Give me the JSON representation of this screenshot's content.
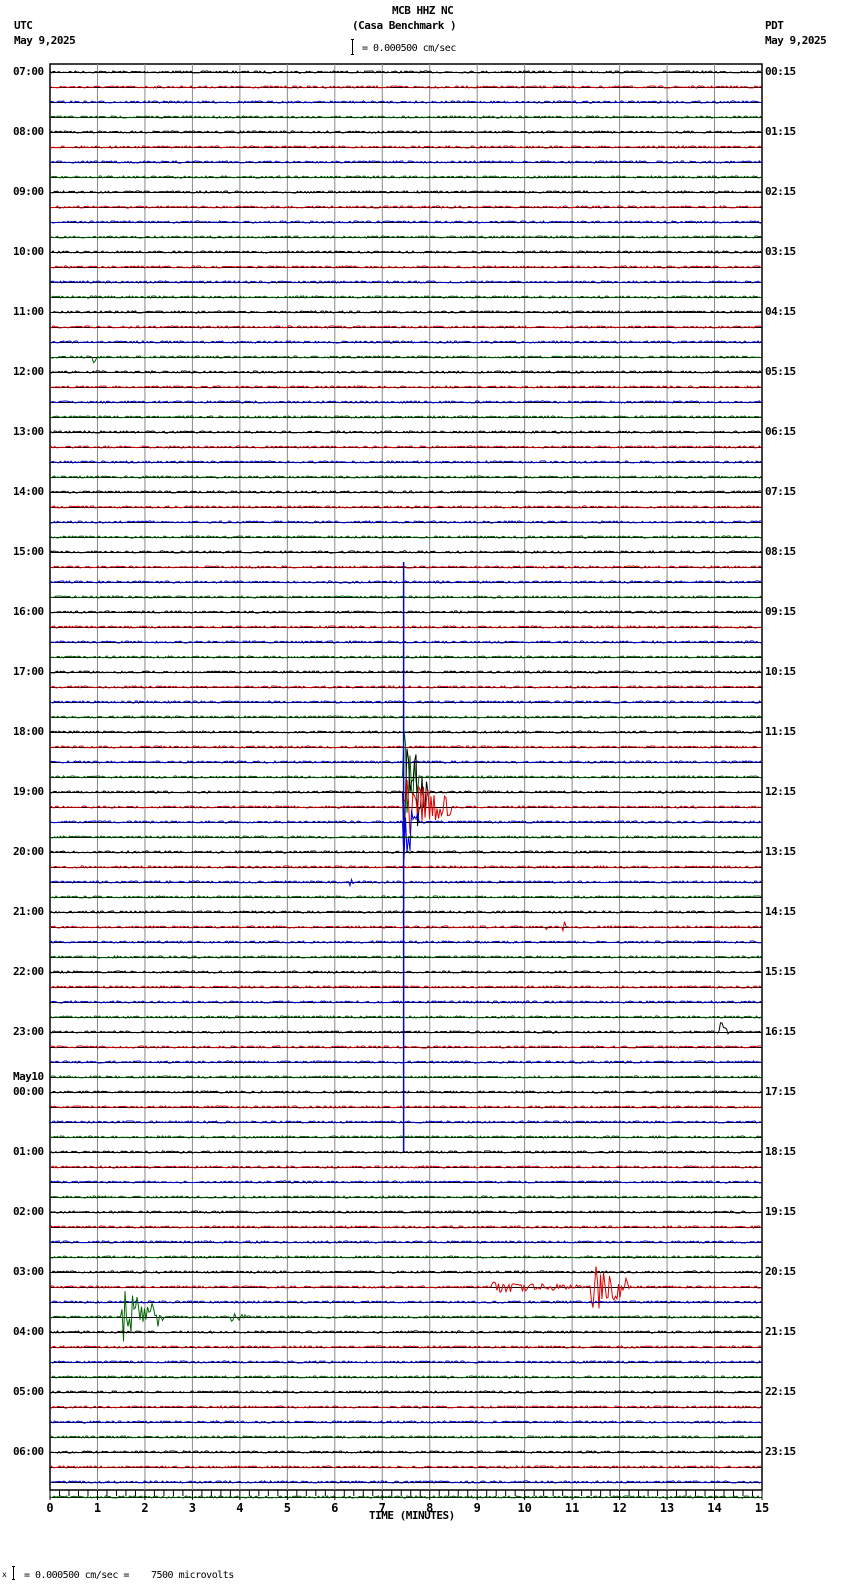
{
  "header": {
    "title": "MCB HHZ NC",
    "subtitle": "(Casa Benchmark )",
    "scale": "= 0.000500 cm/sec",
    "left_tz": "UTC",
    "left_date": "May 9,2025",
    "right_tz": "PDT",
    "right_date": "May 9,2025"
  },
  "footer": {
    "scale": "= 0.000500 cm/sec =    7500 microvolts",
    "prefix": "x"
  },
  "chart_data": {
    "type": "line",
    "title": "MCB HHZ NC (Casa Benchmark )",
    "xlabel": "TIME (MINUTES)",
    "xlim": [
      0,
      15
    ],
    "x_ticks": [
      "0",
      "1",
      "2",
      "3",
      "4",
      "5",
      "6",
      "7",
      "8",
      "9",
      "10",
      "11",
      "12",
      "13",
      "14",
      "15"
    ],
    "left_labels": [
      "07:00",
      "08:00",
      "09:00",
      "10:00",
      "11:00",
      "12:00",
      "13:00",
      "14:00",
      "15:00",
      "16:00",
      "17:00",
      "18:00",
      "19:00",
      "20:00",
      "21:00",
      "22:00",
      "23:00",
      "00:00",
      "01:00",
      "02:00",
      "03:00",
      "04:00",
      "05:00",
      "06:00"
    ],
    "date_change_label": "May10",
    "right_labels": [
      "00:15",
      "01:15",
      "02:15",
      "03:15",
      "04:15",
      "05:15",
      "06:15",
      "07:15",
      "08:15",
      "09:15",
      "10:15",
      "11:15",
      "12:15",
      "13:15",
      "14:15",
      "15:15",
      "16:15",
      "17:15",
      "18:15",
      "19:15",
      "20:15",
      "21:15",
      "22:15",
      "23:15"
    ],
    "trace_colors": [
      "#000000",
      "#dd0000",
      "#0000dd",
      "#006600"
    ],
    "traces_per_hour": 4,
    "events": [
      {
        "trace": 19,
        "minute": 0.9,
        "amplitude": 0.5,
        "duration": 0.1
      },
      {
        "trace": 47,
        "minute": 7.45,
        "amplitude": 3.5,
        "duration": 0.3
      },
      {
        "trace": 48,
        "minute": 7.45,
        "amplitude": 4,
        "duration": 0.5
      },
      {
        "trace": 49,
        "minute": 7.45,
        "amplitude": 2,
        "duration": 1.0
      },
      {
        "trace": 50,
        "minute": 7.45,
        "amplitude": 3,
        "duration": 0.3
      },
      {
        "trace": 54,
        "minute": 6.3,
        "amplitude": 0.5,
        "duration": 0.1
      },
      {
        "trace": 57,
        "minute": 10.4,
        "amplitude": 0.5,
        "duration": 0.1
      },
      {
        "trace": 57,
        "minute": 10.8,
        "amplitude": 0.5,
        "duration": 0.1
      },
      {
        "trace": 64,
        "minute": 14.1,
        "amplitude": 0.8,
        "duration": 0.2
      },
      {
        "trace": 81,
        "minute": 9.3,
        "amplitude": 0.4,
        "duration": 1.9
      },
      {
        "trace": 81,
        "minute": 11.4,
        "amplitude": 1.7,
        "duration": 0.8
      },
      {
        "trace": 83,
        "minute": 1.5,
        "amplitude": 1.9,
        "duration": 0.9
      },
      {
        "trace": 83,
        "minute": 3.8,
        "amplitude": 0.3,
        "duration": 0.4
      }
    ],
    "long_spike": {
      "minute": 7.45,
      "from_trace": 33,
      "to_trace": 72
    }
  }
}
